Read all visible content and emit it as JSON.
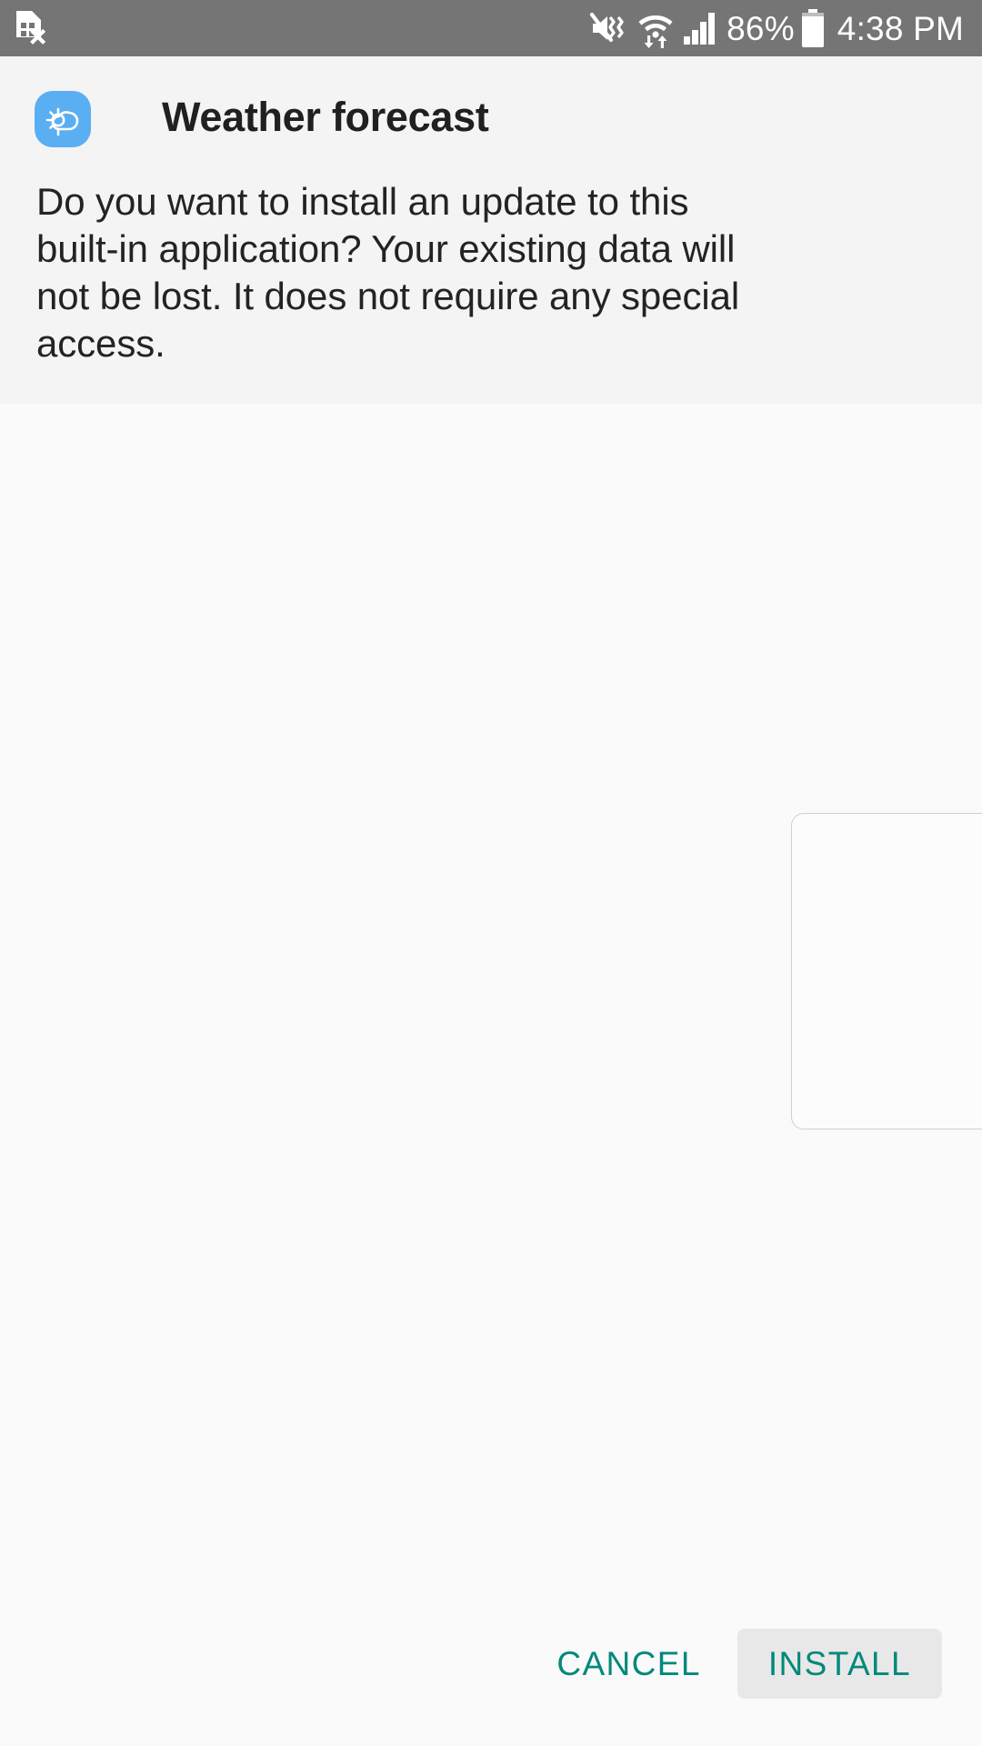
{
  "status_bar": {
    "background_color": "#757575",
    "text_color": "#ffffff",
    "left_icons": [
      {
        "name": "sim-card-error-icon",
        "label": "No SIM card"
      }
    ],
    "right_icons": [
      {
        "name": "volume-mute-vibrate-icon",
        "label": "Sound muted / vibrate"
      },
      {
        "name": "wifi-data-transfer-icon",
        "label": "Wi-Fi connected with data activity"
      },
      {
        "name": "cellular-signal-icon",
        "label": "Cellular signal full"
      }
    ],
    "battery_percent": "86%",
    "battery_icon": "battery-icon",
    "clock": "4:38 PM"
  },
  "dialog": {
    "app_icon": {
      "name": "weather-app-icon",
      "glyph": "sun-behind-cloud",
      "background_color": "#5aaef2",
      "glyph_color": "#ffffff"
    },
    "title": "Weather forecast",
    "message": "Do you want to install an update to this built-in application? Your existing data will not be lost. It does not require any special access.",
    "header_background": "#f4f4f4",
    "body_background": "#fafafa",
    "buttons": [
      {
        "name": "cancel-button",
        "label": "CANCEL",
        "style": "text",
        "text_color": "#00897b"
      },
      {
        "name": "install-button",
        "label": "INSTALL",
        "style": "filled",
        "text_color": "#00897b",
        "background_color": "#e8e8e8"
      }
    ]
  }
}
